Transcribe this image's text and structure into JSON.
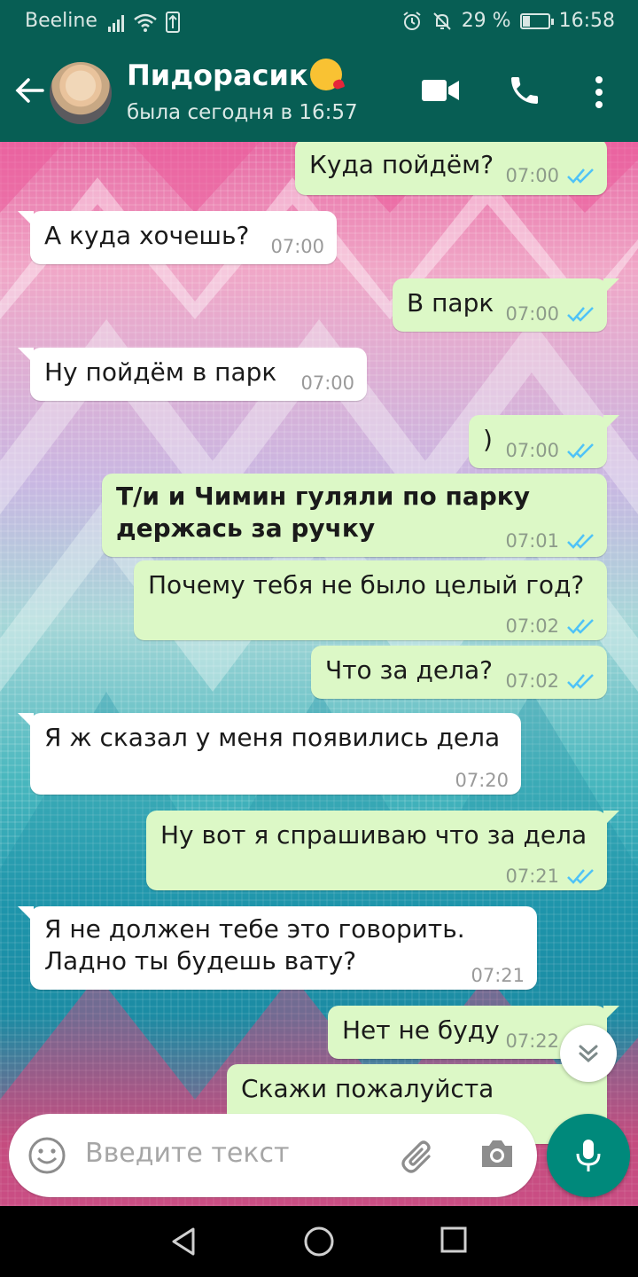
{
  "status_bar": {
    "carrier": "Beeline",
    "battery": "29 %",
    "battery_level": 0.29,
    "time": "16:58"
  },
  "header": {
    "contact_name": "Пидорасик",
    "last_seen": "была сегодня в 16:57"
  },
  "messages": [
    {
      "dir": "out",
      "text": "Куда пойдём?",
      "time": "07:00"
    },
    {
      "dir": "in",
      "text": "А куда хочешь?",
      "time": "07:00"
    },
    {
      "dir": "out",
      "text": "В парк",
      "time": "07:00"
    },
    {
      "dir": "in",
      "text": "Ну пойдём в парк",
      "time": "07:00"
    },
    {
      "dir": "out",
      "text": ")",
      "time": "07:00"
    },
    {
      "dir": "out",
      "line1": "Т/и и Чимин гуляли по парку",
      "line2": "держась за ручку",
      "time": "07:01"
    },
    {
      "dir": "out",
      "text": "Почему тебя не было целый год?",
      "time": "07:02"
    },
    {
      "dir": "out",
      "text": "Что за дела?",
      "time": "07:02"
    },
    {
      "dir": "in",
      "text": "Я ж сказал у меня появились дела",
      "time": "07:20"
    },
    {
      "dir": "out",
      "text": "Ну вот я спрашиваю что за дела",
      "time": "07:21"
    },
    {
      "dir": "in",
      "line1": "Я не должен тебе это говорить.",
      "line2": "Ладно ты будешь вату?",
      "time": "07:21"
    },
    {
      "dir": "out",
      "text": "Нет не буду",
      "time": "07:22"
    },
    {
      "dir": "out",
      "text": "Скажи пожалуйста",
      "time": ""
    }
  ],
  "composer": {
    "placeholder": "Введите текст"
  },
  "colors": {
    "header": "#075e54",
    "outgoing_bubble": "#dcf8c6",
    "incoming_bubble": "#ffffff",
    "read_ticks": "#4fc3f7",
    "mic_button": "#00897b"
  },
  "icons": [
    "back-arrow-icon",
    "video-call-icon",
    "phone-call-icon",
    "more-vert-icon",
    "emoji-icon",
    "attach-icon",
    "camera-icon",
    "mic-icon",
    "chevron-down-icon"
  ]
}
